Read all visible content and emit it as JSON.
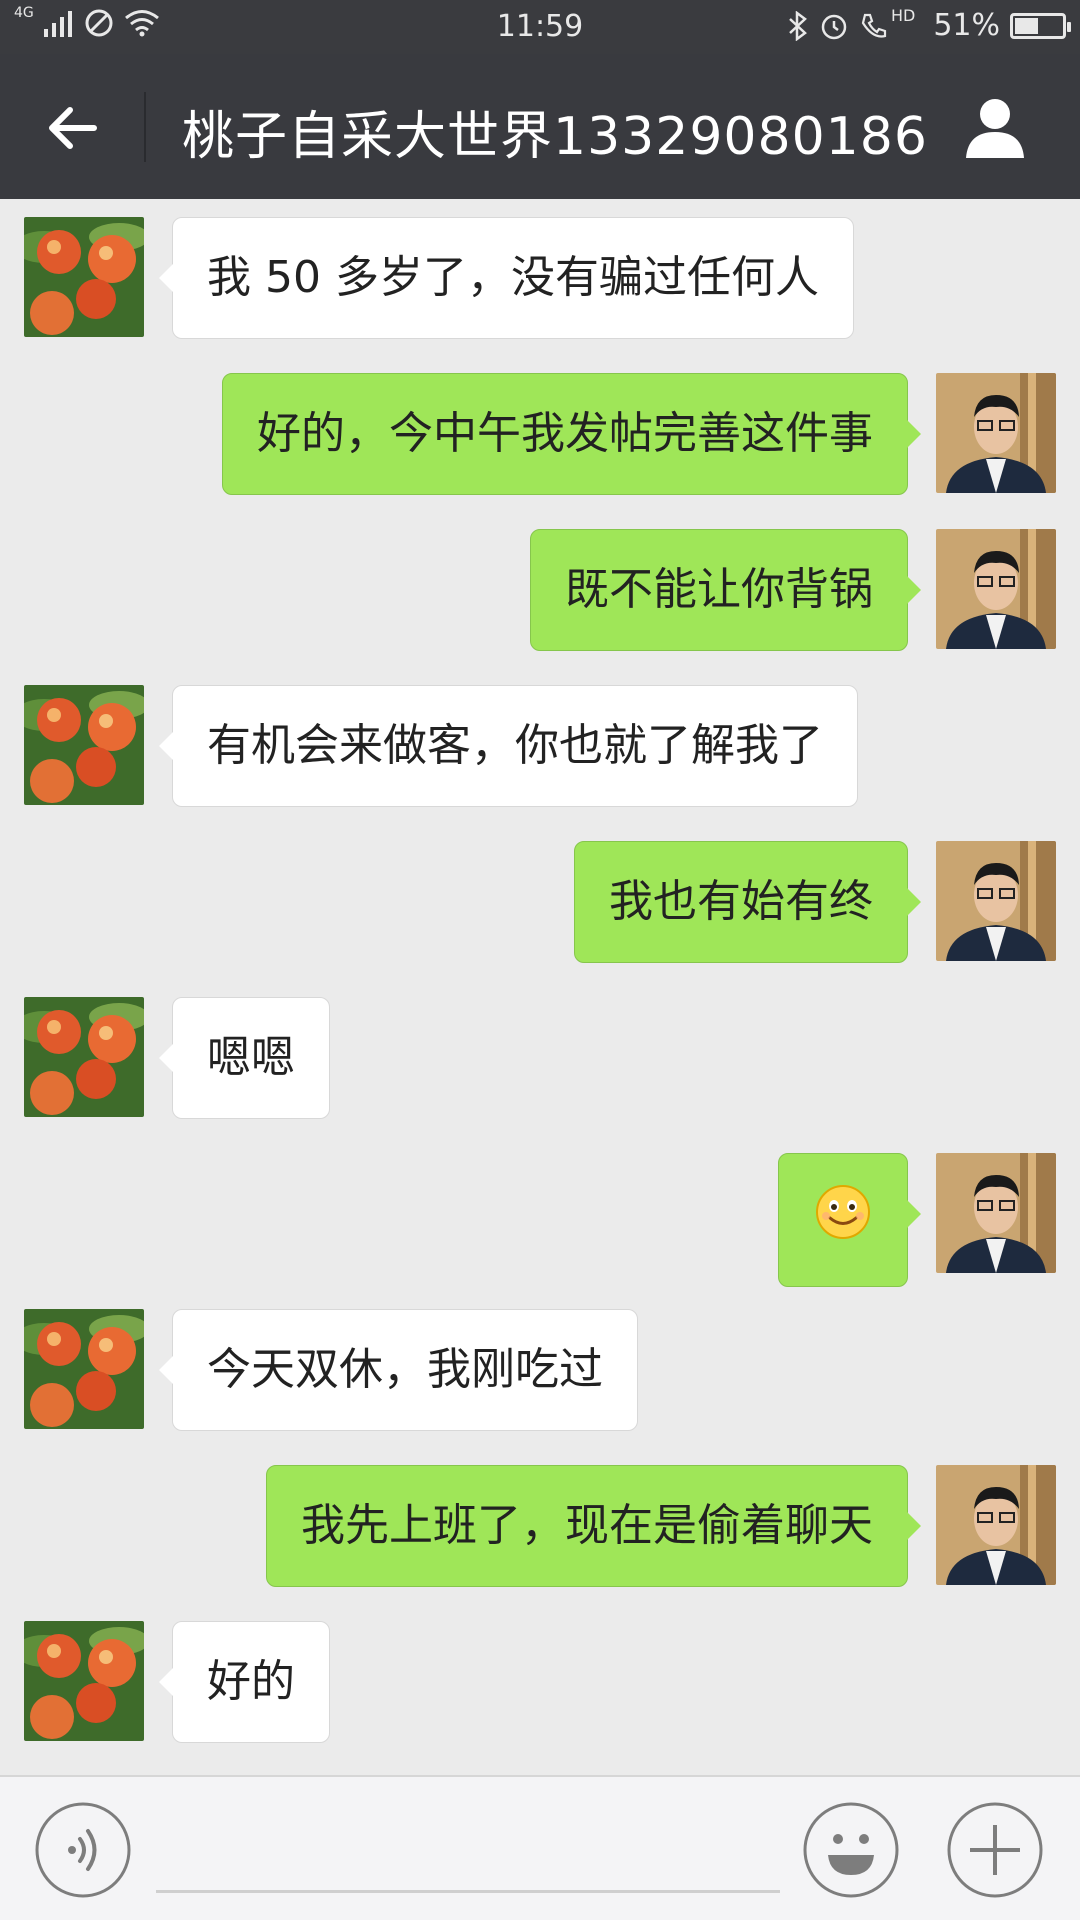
{
  "status_bar": {
    "network": "4G",
    "time": "11:59",
    "hd_label": "HD",
    "battery_percent": "51%",
    "battery_level": 0.51
  },
  "header": {
    "title": "桃子自采大世界13329080186"
  },
  "messages": [
    {
      "side": "left",
      "text": "我 50 多岁了，没有骗过任何人"
    },
    {
      "side": "right",
      "text": "好的，今中午我发帖完善这件事"
    },
    {
      "side": "right",
      "text": "既不能让你背锅"
    },
    {
      "side": "left",
      "text": "有机会来做客，你也就了解我了"
    },
    {
      "side": "right",
      "text": "我也有始有终"
    },
    {
      "side": "left",
      "text": "嗯嗯"
    },
    {
      "side": "right",
      "emoji": "smile-emoji"
    },
    {
      "side": "left",
      "text": "今天双休，我刚吃过"
    },
    {
      "side": "right",
      "text": "我先上班了，现在是偷着聊天"
    },
    {
      "side": "left",
      "text": "好的"
    }
  ],
  "colors": {
    "header_bg": "#393a3f",
    "sent_bubble": "#9fe658",
    "received_bubble": "#ffffff",
    "chat_bg": "#ebebeb"
  }
}
